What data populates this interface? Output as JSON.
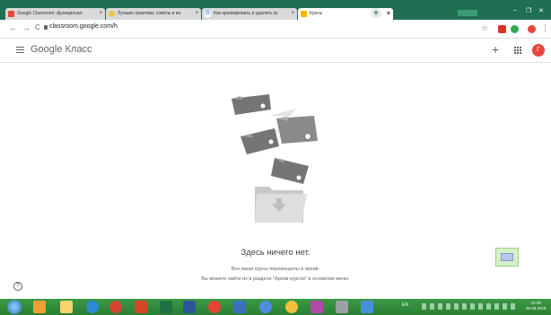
{
  "tabs": [
    {
      "title": "Google Classroom: функционал",
      "fav_color": "#e8453c"
    },
    {
      "title": "Лучшие практики, советы и ин",
      "fav_color": "#f2c744"
    },
    {
      "title": "Как архивировать и удалить ку",
      "fav_color": "#4285f4"
    },
    {
      "title": "Курсы",
      "fav_color": "#f4b400",
      "active": true
    }
  ],
  "tab_close": "×",
  "new_tab": "+",
  "window_controls": {
    "minimize": "–",
    "maximize": "❐",
    "close": "✕"
  },
  "address": {
    "url": "classroom.google.com/h",
    "back": "←",
    "forward": "→",
    "reload": "C",
    "star": "☆",
    "menu": "⋮"
  },
  "app": {
    "menu_icon": "hamburger-menu-icon",
    "logo": "Google Класс",
    "add": "+",
    "avatar_letter": "Г"
  },
  "empty_state": {
    "title": "Здесь ничего нет.",
    "line1": "Все ваши курсы перемещены в архив.",
    "line2": "Вы можете найти их в разделе \"Архив курсов\" в основном меню."
  },
  "help": "?",
  "taskbar": {
    "lang": "EN",
    "time": "12:08",
    "date": "26.06.2018"
  },
  "colors": {
    "tab_strip": "#1f6f52",
    "avatar": "#e8453c",
    "taskbar": "#2b7f34"
  }
}
